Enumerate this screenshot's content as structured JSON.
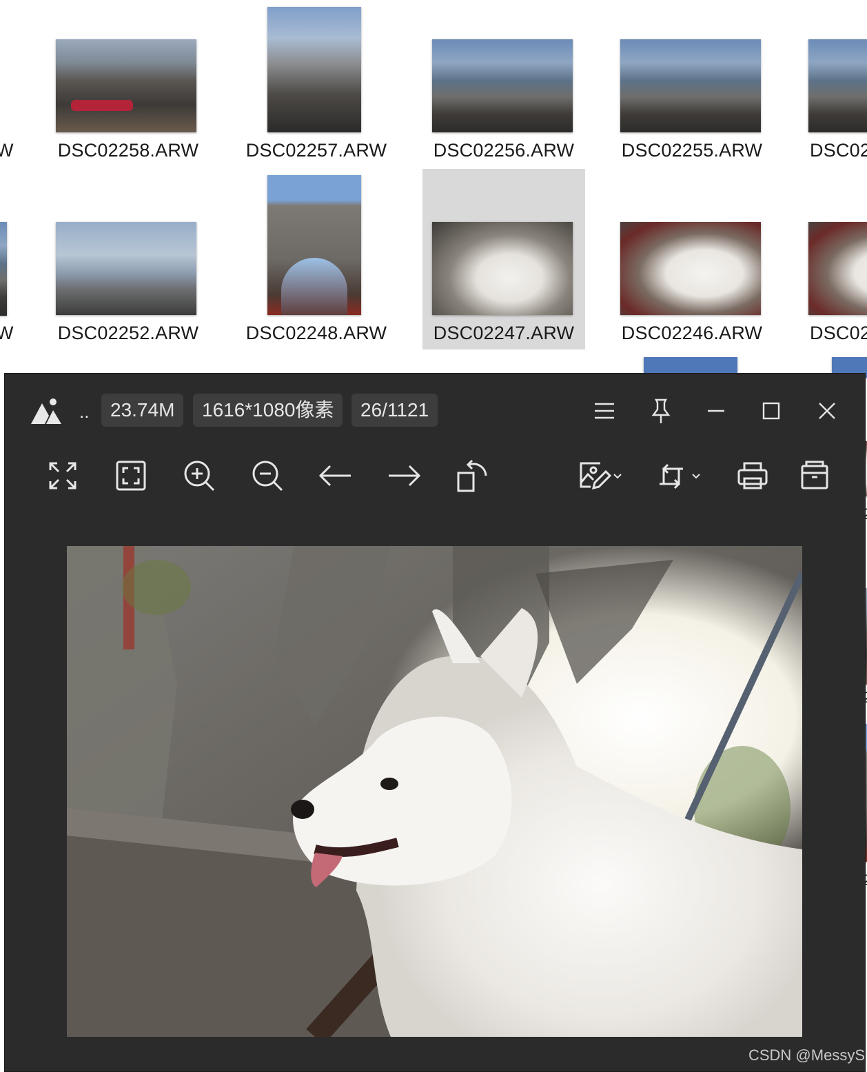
{
  "explorer": {
    "row1": [
      {
        "label": "DSC02258.ARW"
      },
      {
        "label": "DSC02257.ARW"
      },
      {
        "label": "DSC02256.ARW"
      },
      {
        "label": "DSC02255.ARW"
      },
      {
        "label": "DSC02"
      }
    ],
    "row2": [
      {
        "label": "DSC02252.ARW"
      },
      {
        "label": "DSC02248.ARW"
      },
      {
        "label": "DSC02247.ARW"
      },
      {
        "label": "DSC02246.ARW"
      },
      {
        "label": "DSC02"
      }
    ],
    "edge_left_label": "W",
    "right_edge_label": "2"
  },
  "viewer": {
    "dots": "..",
    "file_size": "23.74M",
    "dimensions": "1616*1080像素",
    "counter": "26/1121",
    "titlebar_buttons": [
      "menu-icon",
      "pin-icon",
      "minimize-icon",
      "maximize-icon",
      "close-icon"
    ],
    "tools": [
      "fullscreen-icon",
      "fit-window-icon",
      "zoom-in-icon",
      "zoom-out-icon",
      "previous-arrow-icon",
      "next-arrow-icon",
      "rotate-icon",
      "edit-image-icon",
      "crop-icon",
      "print-icon",
      "archive-icon"
    ]
  },
  "watermark": "CSDN @MessyS"
}
